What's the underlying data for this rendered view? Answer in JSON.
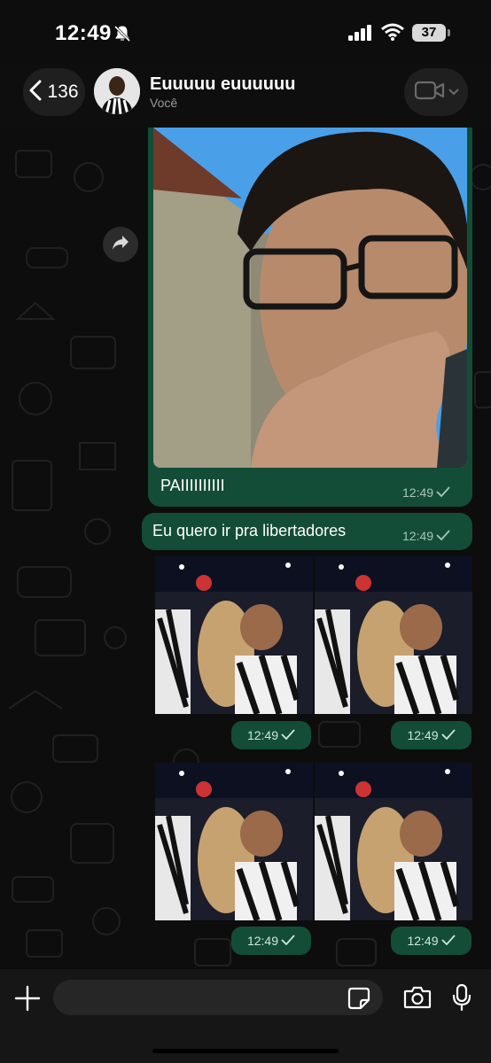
{
  "status_bar": {
    "time": "12:49",
    "battery": "37"
  },
  "header": {
    "back_count": "136",
    "chat_name": "Euuuuu euuuuuu",
    "subtitle": "Você"
  },
  "messages": {
    "photo_caption": "PAIIIIIIIIII",
    "photo_time": "12:49",
    "text": "Eu quero ir pra libertadores",
    "text_time": "12:49",
    "gif_times": [
      "12:49",
      "12:49",
      "12:49",
      "12:49"
    ]
  },
  "input": {
    "placeholder": ""
  },
  "colors": {
    "bubble": "#144d37",
    "meta": "#a8c6b8",
    "background": "#0b0b0b"
  },
  "icons": {
    "back": "chevron-left-icon",
    "video": "video-camera-icon",
    "forward": "forward-arrow-icon",
    "read": "checkmark-icon",
    "plus": "plus-icon",
    "sticker": "sticker-icon",
    "camera": "camera-icon",
    "mic": "microphone-icon"
  }
}
